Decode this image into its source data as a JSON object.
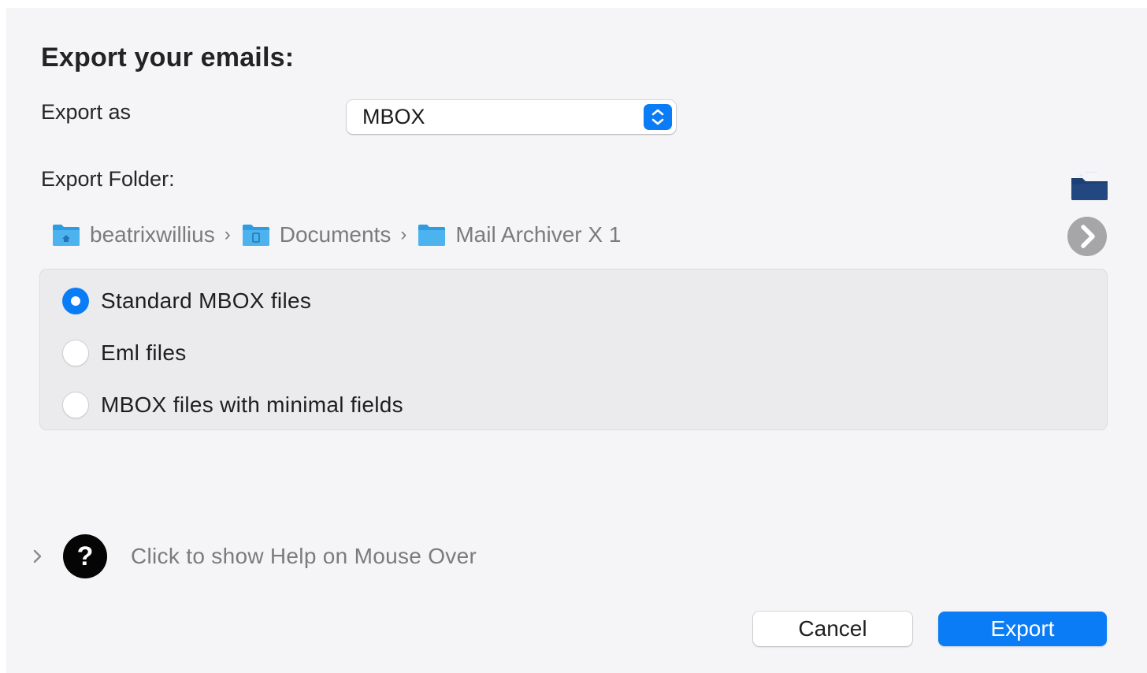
{
  "dialog": {
    "title": "Export your emails:"
  },
  "export_as": {
    "label": "Export as",
    "selected": "MBOX"
  },
  "export_folder": {
    "label": "Export Folder:",
    "path": [
      {
        "label": "beatrixwillius",
        "icon": "home-folder-icon"
      },
      {
        "label": "Documents",
        "icon": "documents-folder-icon"
      },
      {
        "label": "Mail Archiver X 1",
        "icon": "folder-icon"
      }
    ],
    "separator": "›"
  },
  "format_options": {
    "selected_index": 0,
    "items": [
      {
        "label": "Standard MBOX files",
        "selected": true
      },
      {
        "label": "Eml files",
        "selected": false
      },
      {
        "label": "MBOX files with minimal fields",
        "selected": false
      }
    ]
  },
  "help": {
    "icon_glyph": "?",
    "text": "Click to show Help on Mouse Over"
  },
  "buttons": {
    "cancel": "Cancel",
    "export": "Export"
  },
  "colors": {
    "accent": "#0a7cf5",
    "background": "#f5f5f7",
    "options_panel": "#ebebed",
    "folder_icon": "#1e3f73",
    "path_folder": "#3ea9e8"
  }
}
